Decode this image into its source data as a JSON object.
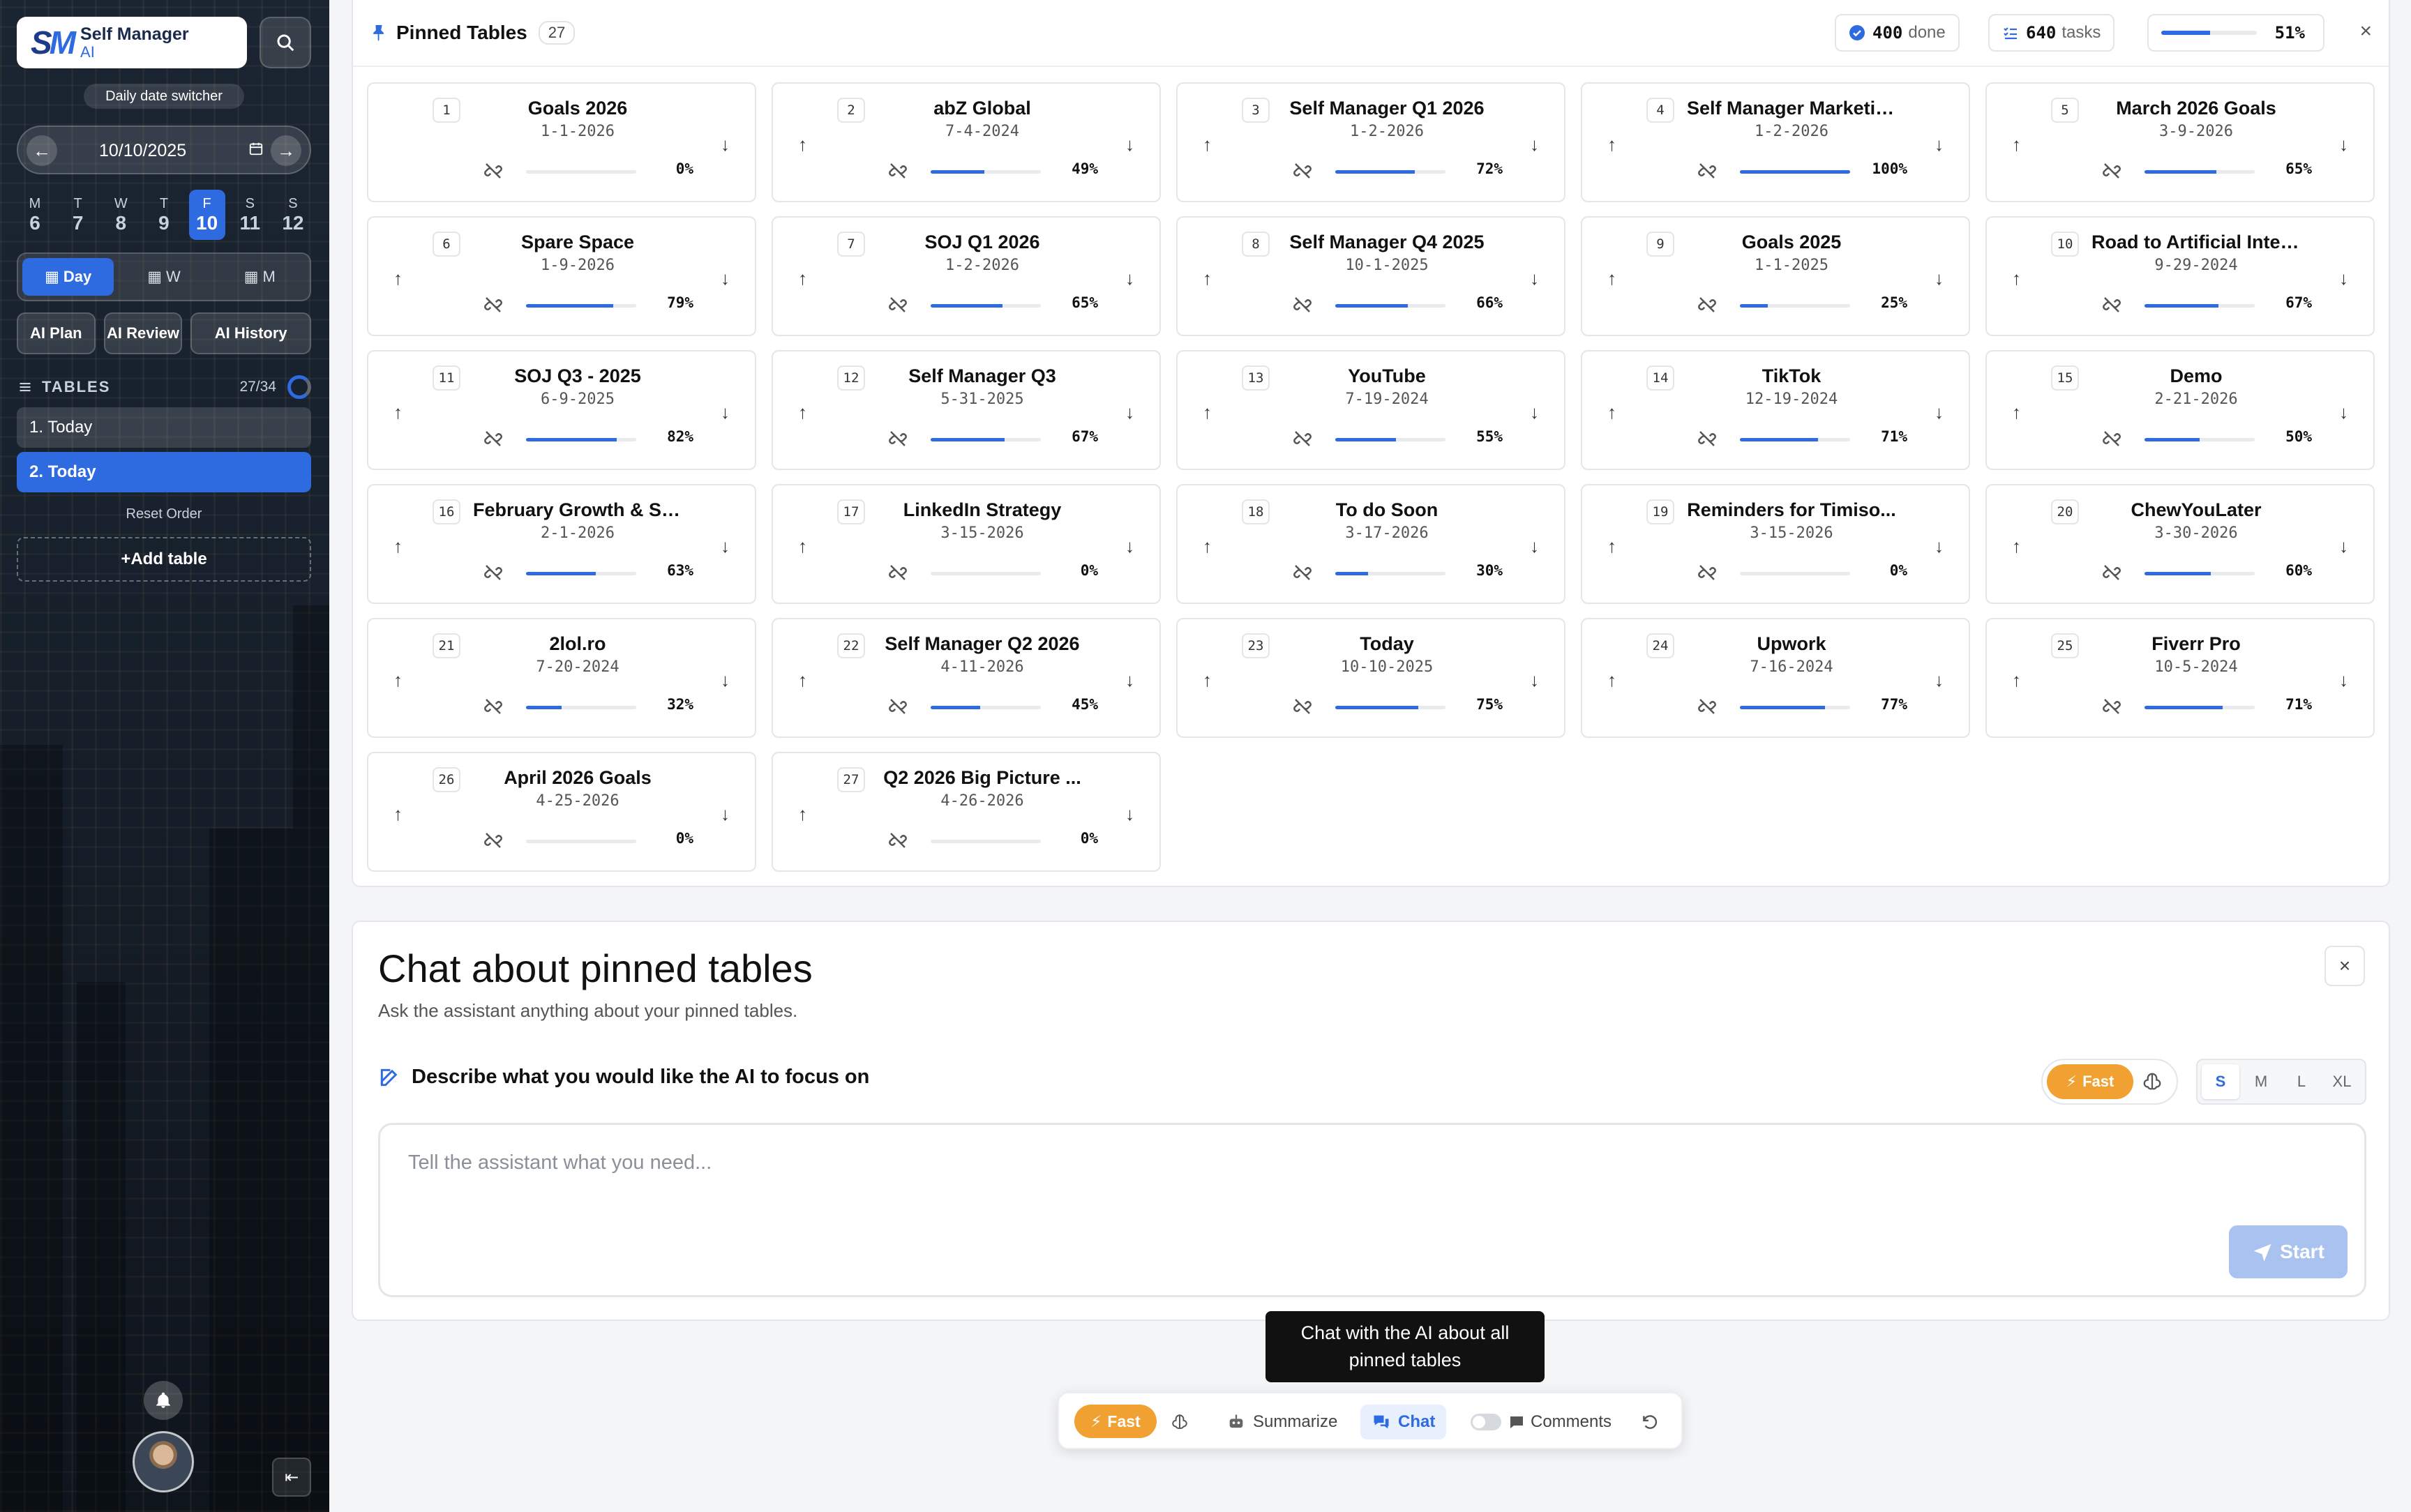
{
  "app": {
    "logo_mark_a": "S",
    "logo_mark_b": "M",
    "name": "Self Manager",
    "suffix": "AI",
    "search_icon": "search-icon"
  },
  "sidebar": {
    "switcher_label": "Daily date switcher",
    "date_value": "10/10/2025",
    "weekdays": [
      {
        "letter": "M",
        "day": "6"
      },
      {
        "letter": "T",
        "day": "7"
      },
      {
        "letter": "W",
        "day": "8"
      },
      {
        "letter": "T",
        "day": "9"
      },
      {
        "letter": "F",
        "day": "10"
      },
      {
        "letter": "S",
        "day": "11"
      },
      {
        "letter": "S",
        "day": "12"
      }
    ],
    "active_weekday_index": 4,
    "views": {
      "day": "Day",
      "week": "W",
      "month": "M"
    },
    "ai_buttons": {
      "plan": "AI Plan",
      "review": "AI Review",
      "history": "AI History"
    },
    "tables_label": "TABLES",
    "tables_count": "27/34",
    "tables": [
      "1. Today",
      "2. Today"
    ],
    "reset_order": "Reset Order",
    "add_table": "+Add table"
  },
  "pinned": {
    "title": "Pinned Tables",
    "count": "27",
    "done_count": "400",
    "done_label": "done",
    "tasks_count": "640",
    "tasks_label": "tasks",
    "overall_pct": "51%",
    "overall_progress": 0.51,
    "cards": [
      {
        "n": "1",
        "name": "Goals 2026",
        "date": "1-1-2026",
        "pct": "0%",
        "p": 0.0,
        "up": false
      },
      {
        "n": "2",
        "name": "abZ Global",
        "date": "7-4-2024",
        "pct": "49%",
        "p": 0.49,
        "up": true
      },
      {
        "n": "3",
        "name": "Self Manager Q1 2026",
        "date": "1-2-2026",
        "pct": "72%",
        "p": 0.72,
        "up": true
      },
      {
        "n": "4",
        "name": "Self Manager Marketin...",
        "date": "1-2-2026",
        "pct": "100%",
        "p": 1.0,
        "up": true
      },
      {
        "n": "5",
        "name": "March 2026 Goals",
        "date": "3-9-2026",
        "pct": "65%",
        "p": 0.65,
        "up": true
      },
      {
        "n": "6",
        "name": "Spare Space",
        "date": "1-9-2026",
        "pct": "79%",
        "p": 0.79,
        "up": true
      },
      {
        "n": "7",
        "name": "SOJ Q1 2026",
        "date": "1-2-2026",
        "pct": "65%",
        "p": 0.65,
        "up": true
      },
      {
        "n": "8",
        "name": "Self Manager Q4 2025",
        "date": "10-1-2025",
        "pct": "66%",
        "p": 0.66,
        "up": true
      },
      {
        "n": "9",
        "name": "Goals 2025",
        "date": "1-1-2025",
        "pct": "25%",
        "p": 0.25,
        "up": true
      },
      {
        "n": "10",
        "name": "Road to Artificial Intel...",
        "date": "9-29-2024",
        "pct": "67%",
        "p": 0.67,
        "up": true
      },
      {
        "n": "11",
        "name": "SOJ Q3 - 2025",
        "date": "6-9-2025",
        "pct": "82%",
        "p": 0.82,
        "up": true
      },
      {
        "n": "12",
        "name": "Self Manager Q3",
        "date": "5-31-2025",
        "pct": "67%",
        "p": 0.67,
        "up": true
      },
      {
        "n": "13",
        "name": "YouTube",
        "date": "7-19-2024",
        "pct": "55%",
        "p": 0.55,
        "up": true
      },
      {
        "n": "14",
        "name": "TikTok",
        "date": "12-19-2024",
        "pct": "71%",
        "p": 0.71,
        "up": true
      },
      {
        "n": "15",
        "name": "Demo",
        "date": "2-21-2026",
        "pct": "50%",
        "p": 0.5,
        "up": true
      },
      {
        "n": "16",
        "name": "February Growth & St...",
        "date": "2-1-2026",
        "pct": "63%",
        "p": 0.63,
        "up": true
      },
      {
        "n": "17",
        "name": "LinkedIn Strategy",
        "date": "3-15-2026",
        "pct": "0%",
        "p": 0.0,
        "up": true
      },
      {
        "n": "18",
        "name": "To do Soon",
        "date": "3-17-2026",
        "pct": "30%",
        "p": 0.3,
        "up": true
      },
      {
        "n": "19",
        "name": "Reminders for Timiso...",
        "date": "3-15-2026",
        "pct": "0%",
        "p": 0.0,
        "up": true
      },
      {
        "n": "20",
        "name": "ChewYouLater",
        "date": "3-30-2026",
        "pct": "60%",
        "p": 0.6,
        "up": true
      },
      {
        "n": "21",
        "name": "2lol.ro",
        "date": "7-20-2024",
        "pct": "32%",
        "p": 0.32,
        "up": true
      },
      {
        "n": "22",
        "name": "Self Manager Q2 2026",
        "date": "4-11-2026",
        "pct": "45%",
        "p": 0.45,
        "up": true
      },
      {
        "n": "23",
        "name": "Today",
        "date": "10-10-2025",
        "pct": "75%",
        "p": 0.75,
        "up": true
      },
      {
        "n": "24",
        "name": "Upwork",
        "date": "7-16-2024",
        "pct": "77%",
        "p": 0.77,
        "up": true
      },
      {
        "n": "25",
        "name": "Fiverr Pro",
        "date": "10-5-2024",
        "pct": "71%",
        "p": 0.71,
        "up": true
      },
      {
        "n": "26",
        "name": "April 2026 Goals",
        "date": "4-25-2026",
        "pct": "0%",
        "p": 0.0,
        "up": true
      },
      {
        "n": "27",
        "name": "Q2 2026 Big Picture ...",
        "date": "4-26-2026",
        "pct": "0%",
        "p": 0.0,
        "up": true
      }
    ]
  },
  "chat": {
    "title": "Chat about pinned tables",
    "subtitle": "Ask the assistant anything about your pinned tables.",
    "focus_label": "Describe what you would like the AI to focus on",
    "fast_label": "Fast",
    "sizes": [
      "S",
      "M",
      "L",
      "XL"
    ],
    "active_size": "S",
    "placeholder": "Tell the assistant what you need...",
    "start_label": "Start"
  },
  "tooltip": "Chat with the AI about all pinned tables",
  "bottom_bar": {
    "fast": "Fast",
    "summarize": "Summarize",
    "chat": "Chat",
    "comments": "Comments"
  },
  "colors": {
    "accent": "#2f6be0",
    "fast": "#f0a131",
    "start_disabled": "#a9c2ef"
  }
}
